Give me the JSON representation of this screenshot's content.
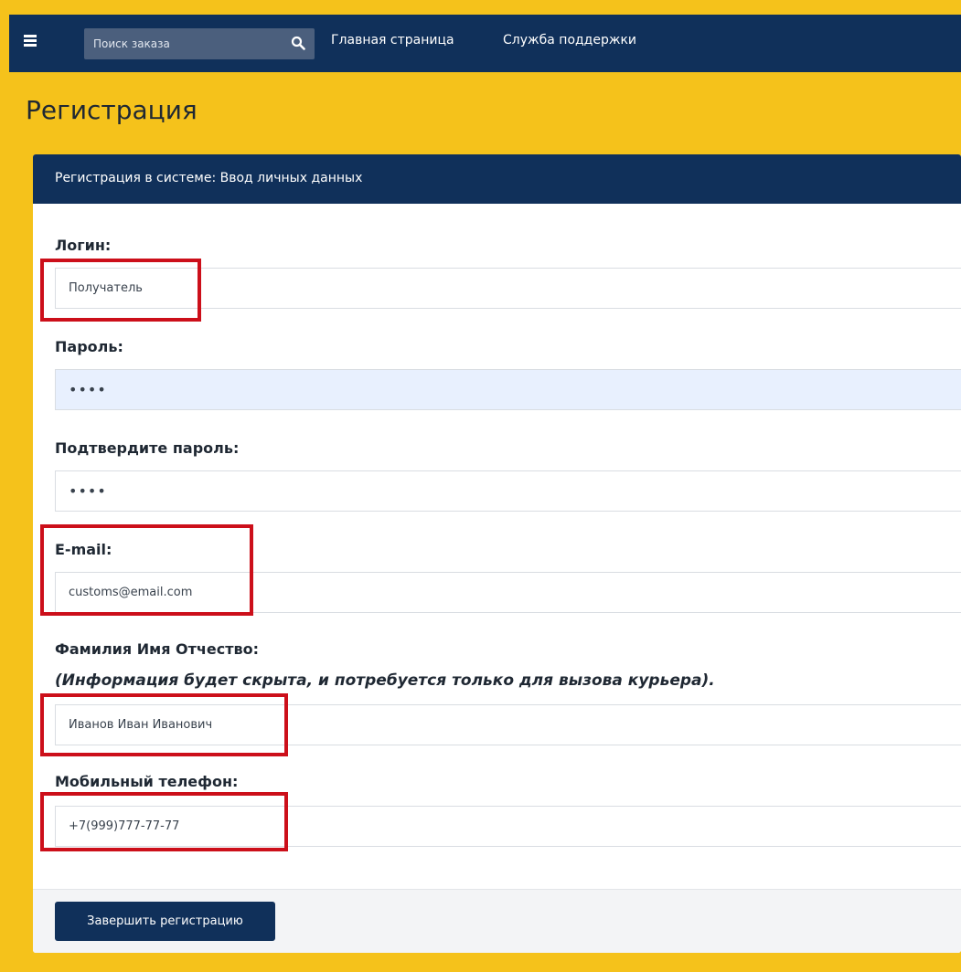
{
  "navbar": {
    "menu_icon": "hamburger-menu-icon",
    "search_placeholder": "Поиск заказа",
    "search_icon": "search-icon",
    "home_label": "Главная страница",
    "support_label": "Служба поддержки"
  },
  "page": {
    "title": "Регистрация"
  },
  "card": {
    "header": "Регистрация в системе: Ввод личных данных"
  },
  "form": {
    "login": {
      "label": "Логин:",
      "value": "Получатель"
    },
    "password": {
      "label": "Пароль:",
      "value": "••••"
    },
    "confirm_password": {
      "label": "Подтвердите пароль:",
      "value": "••••"
    },
    "email": {
      "label": "E-mail:",
      "value": "customs@email.com"
    },
    "full_name": {
      "label": "Фамилия Имя Отчество:",
      "note": "(Информация будет скрыта, и потребуется только для вызова курьера).",
      "value": "Иванов Иван Иванович"
    },
    "phone": {
      "label": "Мобильный телефон:",
      "value": "+7(999)777-77-77"
    },
    "submit_label": "Завершить регистрацию"
  },
  "colors": {
    "background": "#f5c21b",
    "navbar": "#10305a",
    "highlight": "#cc0f1a",
    "autofill": "#e8f0fe"
  }
}
